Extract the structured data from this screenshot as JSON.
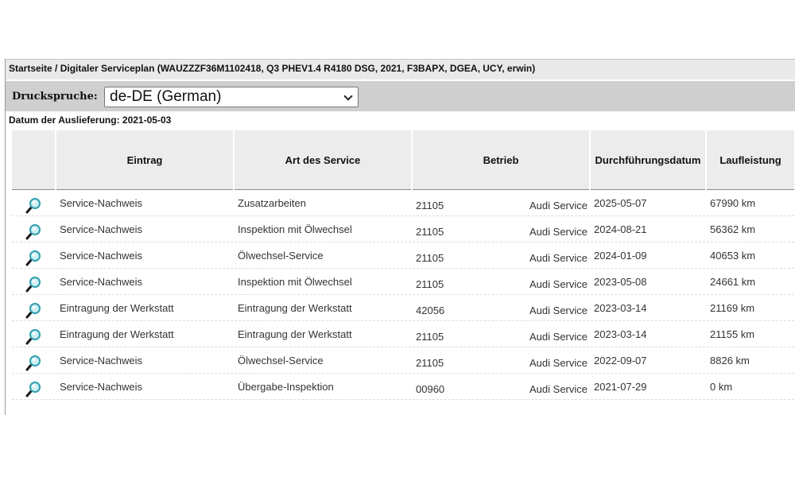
{
  "breadcrumb": "Startseite / Digitaler Serviceplan (WAUZZZF36M1102418, Q3 PHEV1.4 R4180 DSG, 2021, F3BAPX, DGEA, UCY, erwin)",
  "print_language": {
    "label": "Druckspruche:",
    "selected": "de-DE (German)"
  },
  "delivery_date": "Datum der Auslieferung: 2021-05-03",
  "table": {
    "headers": [
      "Eintrag",
      "Art des Service",
      "Betrieb",
      "Durchführungsdatum",
      "Laufleistung"
    ],
    "rows": [
      {
        "eintrag": "Service-Nachweis",
        "art": "Zusatzarbeiten",
        "betrieb_nr": "21105",
        "betrieb_name": "Audi Service",
        "datum": "2025-05-07",
        "laufleistung": "67990 km"
      },
      {
        "eintrag": "Service-Nachweis",
        "art": "Inspektion mit Ölwechsel",
        "betrieb_nr": "21105",
        "betrieb_name": "Audi Service",
        "datum": "2024-08-21",
        "laufleistung": "56362 km"
      },
      {
        "eintrag": "Service-Nachweis",
        "art": "Ölwechsel-Service",
        "betrieb_nr": "21105",
        "betrieb_name": "Audi Service",
        "datum": "2024-01-09",
        "laufleistung": "40653 km"
      },
      {
        "eintrag": "Service-Nachweis",
        "art": "Inspektion mit Ölwechsel",
        "betrieb_nr": "21105",
        "betrieb_name": "Audi Service",
        "datum": "2023-05-08",
        "laufleistung": "24661 km"
      },
      {
        "eintrag": "Eintragung der Werkstatt",
        "art": "Eintragung der Werkstatt",
        "betrieb_nr": "42056",
        "betrieb_name": "Audi Service",
        "datum": "2023-03-14",
        "laufleistung": "21169 km"
      },
      {
        "eintrag": "Eintragung der Werkstatt",
        "art": "Eintragung der Werkstatt",
        "betrieb_nr": "21105",
        "betrieb_name": "Audi Service",
        "datum": "2023-03-14",
        "laufleistung": "21155 km"
      },
      {
        "eintrag": "Service-Nachweis",
        "art": "Ölwechsel-Service",
        "betrieb_nr": "21105",
        "betrieb_name": "Audi Service",
        "datum": "2022-09-07",
        "laufleistung": "8826 km"
      },
      {
        "eintrag": "Service-Nachweis",
        "art": "Übergabe-Inspektion",
        "betrieb_nr": "00960",
        "betrieb_name": "Audi Service",
        "datum": "2021-07-29",
        "laufleistung": "0 km"
      }
    ]
  },
  "icons": {
    "row_detail": "magnifier-icon"
  },
  "colors": {
    "header_bg": "#ececec",
    "toolbar_bg": "#cfcfcf",
    "magnifier_lens": "#3bb3c3"
  }
}
